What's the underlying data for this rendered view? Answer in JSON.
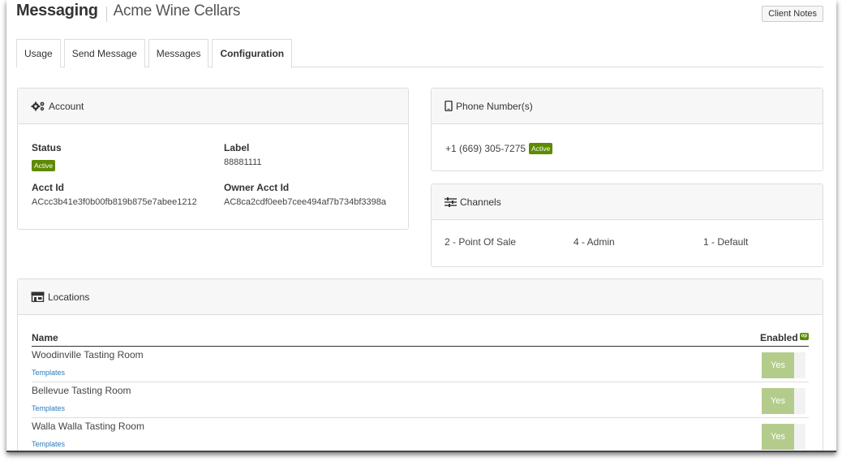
{
  "header": {
    "app_title": "Messaging",
    "company": "Acme Wine Cellars",
    "client_notes_label": "Client Notes"
  },
  "tabs": [
    {
      "label": "Usage",
      "active": false
    },
    {
      "label": "Send Message",
      "active": false
    },
    {
      "label": "Messages",
      "active": false
    },
    {
      "label": "Configuration",
      "active": true
    }
  ],
  "account": {
    "title": "Account",
    "icon": "gears-icon",
    "status_label": "Status",
    "status_value": "Active",
    "label_label": "Label",
    "label_value": "88881111",
    "acct_id_label": "Acct Id",
    "acct_id_value": "ACcc3b41e3f0b00fb819b875e7abee1212",
    "owner_acct_id_label": "Owner Acct Id",
    "owner_acct_id_value": "AC8ca2cdf0eeb7cee494af7b734bf3398a"
  },
  "phone": {
    "title": "Phone Number(s)",
    "icon": "mobile-phone-icon",
    "number": "+1 (669) 305-7275",
    "status": "Active"
  },
  "channels": {
    "title": "Channels",
    "icon": "sliders-icon",
    "items": [
      "2 - Point Of Sale",
      "4 - Admin",
      "1 - Default"
    ]
  },
  "locations": {
    "title": "Locations",
    "icon": "storefront-icon",
    "col_name": "Name",
    "col_enabled": "Enabled",
    "enabled_badge": "op",
    "rows": [
      {
        "name": "Woodinville Tasting Room",
        "link": "Templates",
        "enabled": "Yes"
      },
      {
        "name": "Bellevue Tasting Room",
        "link": "Templates",
        "enabled": "Yes"
      },
      {
        "name": "Walla Walla Tasting Room",
        "link": "Templates",
        "enabled": "Yes"
      }
    ]
  },
  "colors": {
    "active_green": "#5c8a00",
    "toggle_on": "#b3cc8c",
    "link_blue": "#2a7bbf",
    "panel_header_bg": "#f7f7f7"
  }
}
